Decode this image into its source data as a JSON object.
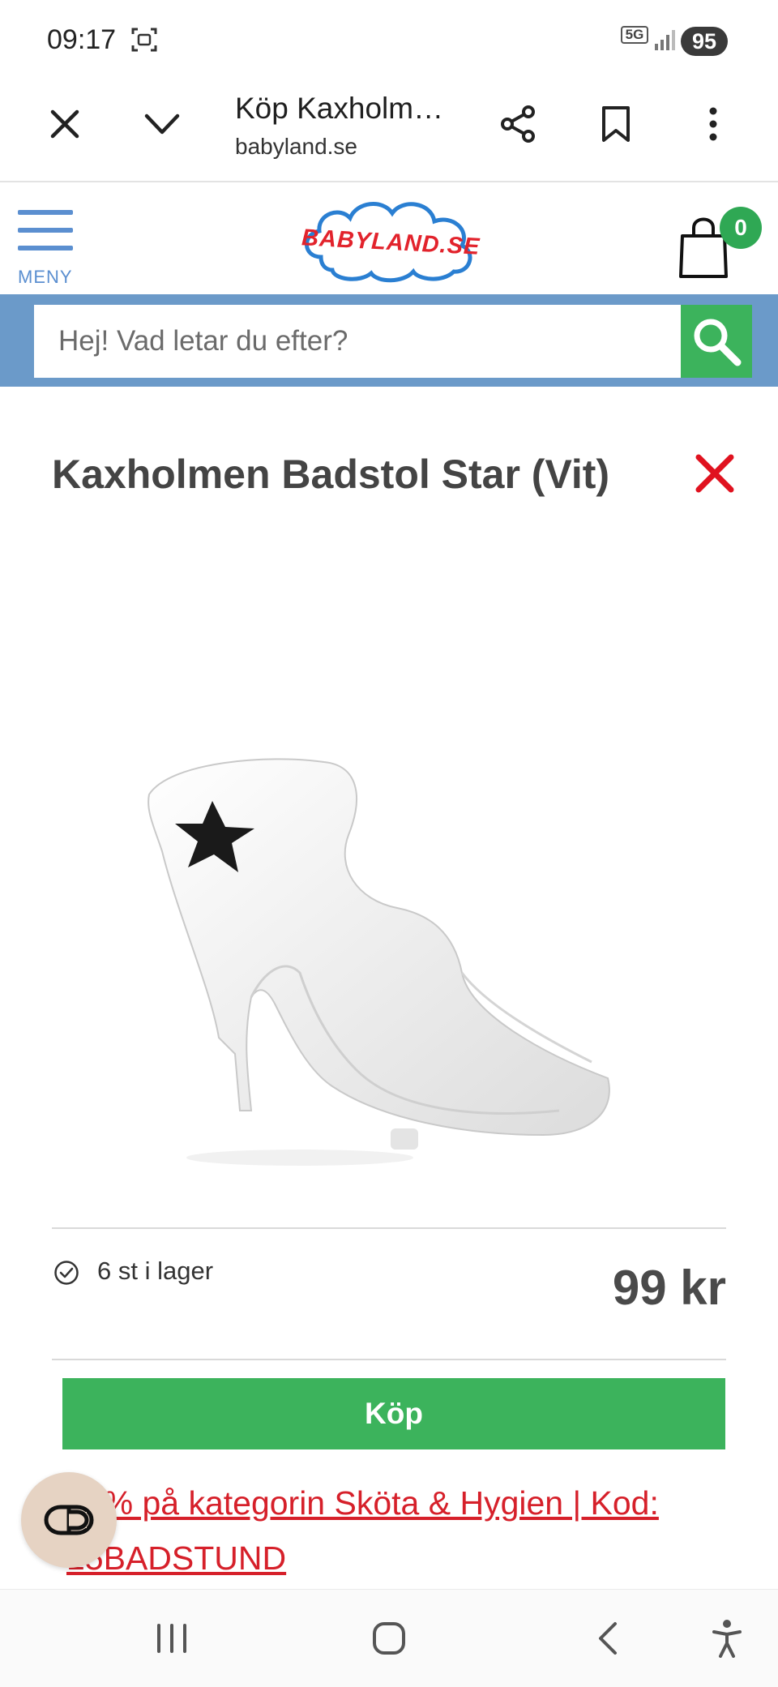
{
  "status_bar": {
    "time": "09:17",
    "network": "5G",
    "battery": "95"
  },
  "browser": {
    "page_title": "Köp Kaxholmen Badstol Star (Vit)",
    "domain": "babyland.se",
    "icons": [
      "close-icon",
      "chevron-down-icon",
      "share-icon",
      "bookmark-icon",
      "more-vert-icon"
    ]
  },
  "site_header": {
    "menu_label": "MENY",
    "logo_text": "BABYLAND.SE",
    "cart_count": "0"
  },
  "search": {
    "placeholder": "Hej! Vad letar du efter?"
  },
  "product": {
    "title": "Kaxholmen Badstol Star (Vit)",
    "stock": "6 st i lager",
    "price": "99 kr",
    "buy_label": "Köp",
    "promo": "15% på kategorin Sköta & Hygien | Kod: 15BADSTUND"
  },
  "colors": {
    "brand_blue": "#6b9ac9",
    "green": "#3cb35c",
    "promo_red": "#d6202a",
    "close_red": "#e0121f"
  }
}
